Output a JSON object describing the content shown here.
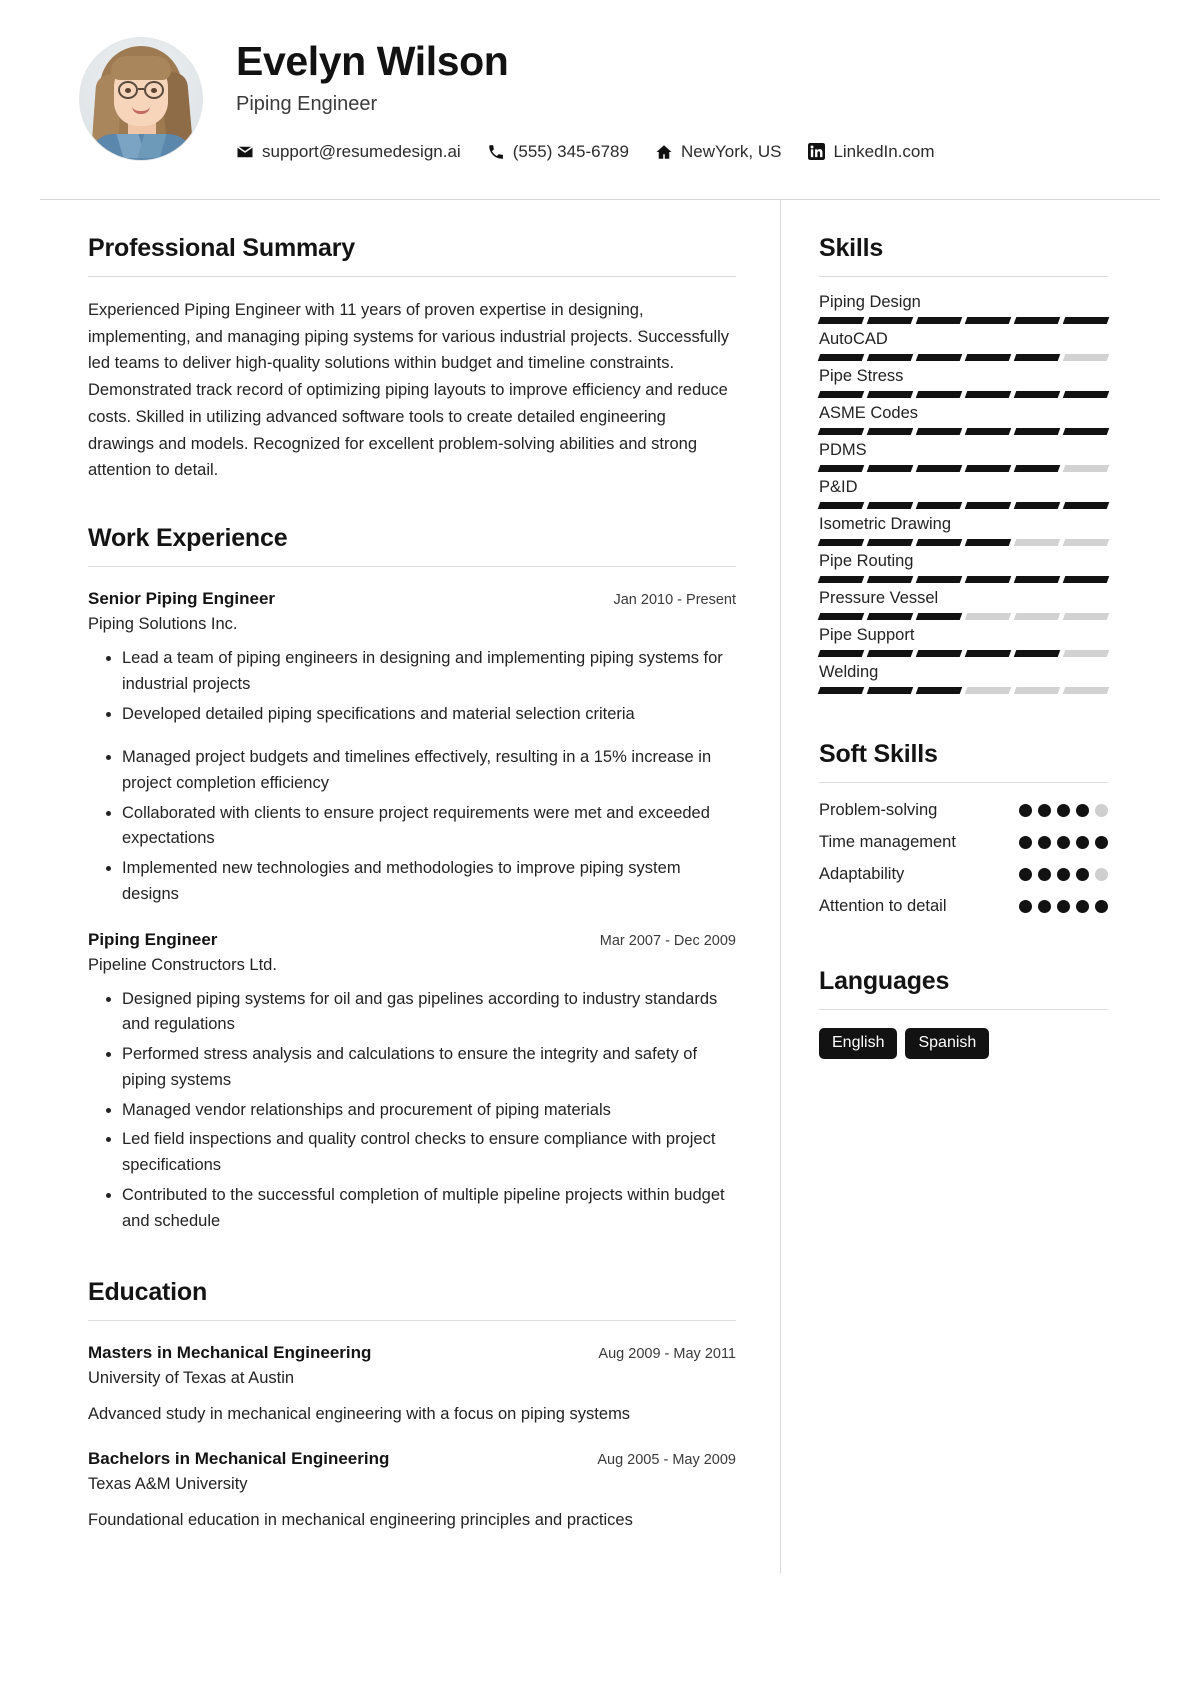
{
  "header": {
    "name": "Evelyn Wilson",
    "job_title": "Piping Engineer",
    "avatar_alt": "portrait-photo",
    "contacts": [
      {
        "icon": "envelope-icon",
        "text": "support@resumedesign.ai"
      },
      {
        "icon": "phone-icon",
        "text": "(555) 345-6789"
      },
      {
        "icon": "home-icon",
        "text": "NewYork, US"
      },
      {
        "icon": "linkedin-icon",
        "text": "LinkedIn.com"
      }
    ]
  },
  "main": {
    "summary": {
      "title": "Professional Summary",
      "text": "Experienced Piping Engineer with 11 years of proven expertise in designing, implementing, and managing piping systems for various industrial projects. Successfully led teams to deliver high-quality solutions within budget and timeline constraints. Demonstrated track record of optimizing piping layouts to improve efficiency and reduce costs. Skilled in utilizing advanced software tools to create detailed engineering drawings and models. Recognized for excellent problem-solving abilities and strong attention to detail."
    },
    "work": {
      "title": "Work Experience",
      "jobs": [
        {
          "role": "Senior Piping Engineer",
          "date": "Jan 2010 - Present",
          "company": "Piping Solutions Inc.",
          "bullets": [
            "Lead a team of piping engineers in designing and implementing piping systems for industrial projects",
            "Developed detailed piping specifications and material selection criteria",
            "Managed project budgets and timelines effectively, resulting in a 15% increase in project completion efficiency",
            "Collaborated with clients to ensure project requirements were met and exceeded expectations",
            "Implemented new technologies and methodologies to improve piping system designs"
          ]
        },
        {
          "role": "Piping Engineer",
          "date": "Mar 2007 - Dec 2009",
          "company": "Pipeline Constructors Ltd.",
          "bullets": [
            "Designed piping systems for oil and gas pipelines according to industry standards and regulations",
            "Performed stress analysis and calculations to ensure the integrity and safety of piping systems",
            "Managed vendor relationships and procurement of piping materials",
            "Led field inspections and quality control checks to ensure compliance with project specifications",
            "Contributed to the successful completion of multiple pipeline projects within budget and schedule"
          ]
        }
      ]
    },
    "education": {
      "title": "Education",
      "items": [
        {
          "degree": "Masters in Mechanical Engineering",
          "date": "Aug 2009 - May 2011",
          "school": "University of Texas at Austin",
          "description": "Advanced study in mechanical engineering with a focus on piping systems"
        },
        {
          "degree": "Bachelors in Mechanical Engineering",
          "date": "Aug 2005 - May 2009",
          "school": "Texas A&M University",
          "description": "Foundational education in mechanical engineering principles and practices"
        }
      ]
    }
  },
  "sidebar": {
    "skills": {
      "title": "Skills",
      "max_segments": 6,
      "items": [
        {
          "name": "Piping Design",
          "level": 6
        },
        {
          "name": "AutoCAD",
          "level": 5
        },
        {
          "name": "Pipe Stress",
          "level": 6
        },
        {
          "name": "ASME Codes",
          "level": 6
        },
        {
          "name": "PDMS",
          "level": 5
        },
        {
          "name": "P&ID",
          "level": 6
        },
        {
          "name": "Isometric Drawing",
          "level": 4
        },
        {
          "name": "Pipe Routing",
          "level": 6
        },
        {
          "name": "Pressure Vessel",
          "level": 3
        },
        {
          "name": "Pipe Support",
          "level": 5
        },
        {
          "name": "Welding",
          "level": 3
        }
      ]
    },
    "soft_skills": {
      "title": "Soft Skills",
      "max_dots": 5,
      "items": [
        {
          "name": "Problem-solving",
          "level": 4
        },
        {
          "name": "Time management",
          "level": 5
        },
        {
          "name": "Adaptability",
          "level": 4
        },
        {
          "name": "Attention to detail",
          "level": 5
        }
      ]
    },
    "languages": {
      "title": "Languages",
      "items": [
        "English",
        "Spanish"
      ]
    }
  },
  "colors": {
    "accent": "#121212",
    "bar_on": "#121212",
    "bar_off": "#d2d2d2",
    "rule": "#dcdcdc",
    "text": "#232323"
  }
}
